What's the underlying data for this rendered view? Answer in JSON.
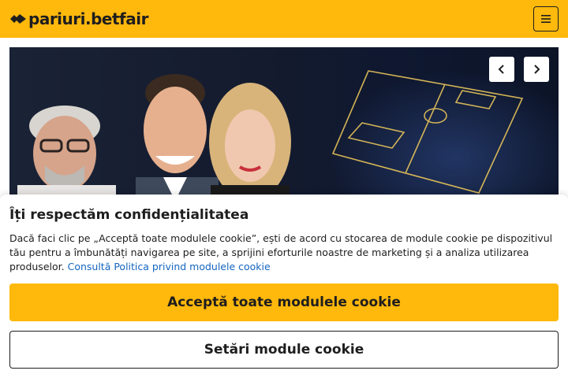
{
  "header": {
    "brand": "pariuri.betfair",
    "brand_color": "#ffb80c",
    "logo_icon": "betfair-arrow-logo-icon",
    "menu_icon": "hamburger-menu-icon"
  },
  "hero": {
    "image_description_icon": "presenters-and-football-pitch-banner",
    "prev_icon": "chevron-left-icon",
    "next_icon": "chevron-right-icon"
  },
  "cookie_banner": {
    "title": "Îți respectăm confidențialitatea",
    "body": "Dacă faci clic pe „Acceptă toate modulele cookie”, ești de acord cu stocarea de module cookie pe dispozitivul tău pentru a îmbunătăți navigarea pe site, a sprijini eforturile noastre de marketing și a analiza utilizarea produselor.",
    "policy_link": "Consultă Politica privind modulele cookie",
    "accept_label": "Acceptă toate modulele cookie",
    "settings_label": "Setări module cookie",
    "link_color": "#1565c0"
  }
}
